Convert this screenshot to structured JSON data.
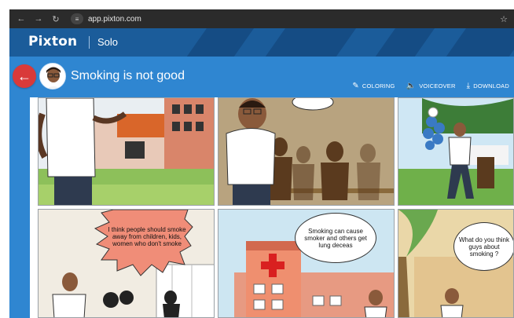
{
  "browser": {
    "url": "app.pixton.com",
    "icons": [
      "back-icon",
      "forward-icon",
      "reload-icon",
      "site-settings-icon",
      "bookmark-star-icon"
    ]
  },
  "app": {
    "logo": "Pixton",
    "mode": "Solo"
  },
  "story": {
    "title": "Smoking is not good"
  },
  "tools": [
    {
      "label": "COLORING",
      "icon": "paint-brush-icon"
    },
    {
      "label": "VOICEOVER",
      "icon": "speaker-icon"
    },
    {
      "label": "DOWNLOAD",
      "icon": "download-icon"
    }
  ],
  "panels": {
    "p4_speech": "I think people should smoke away from children, kids, women who don't smoke",
    "p5_speech": "Smoking can cause smoker and others get lung deceas",
    "p6_speech": "What do you think guys about smoking ?"
  },
  "colors": {
    "header": "#1b5c9a",
    "title_bar": "#2f86d1",
    "back_button": "#d93a3a"
  }
}
